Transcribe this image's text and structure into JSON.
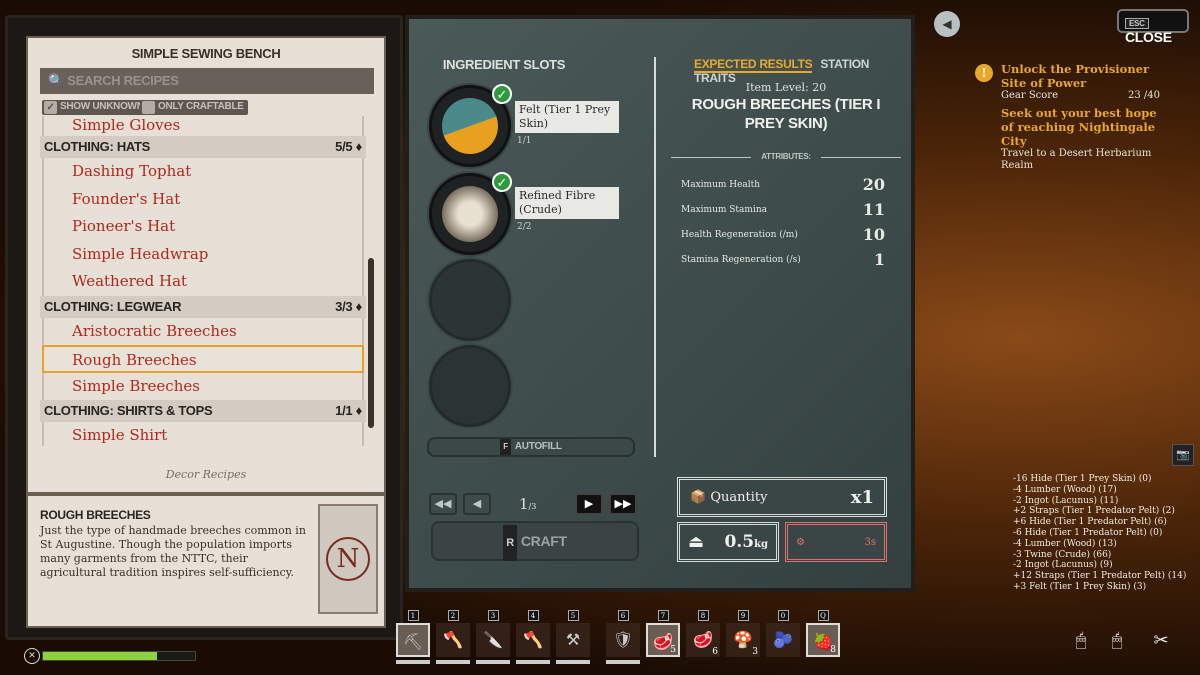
{
  "station": {
    "title": "SIMPLE SEWING BENCH",
    "search_placeholder": "SEARCH RECIPES",
    "show_unknown": "SHOW UNKNOWN",
    "only_craftable": "ONLY CRAFTABLE",
    "show_unknown_checked": true,
    "only_craftable_checked": false
  },
  "recipes": {
    "partial_item": "Simple Gloves",
    "groups": [
      {
        "name": "CLOTHING: HATS",
        "count": "5/5",
        "items": [
          "Dashing Tophat",
          "Founder's Hat",
          "Pioneer's Hat",
          "Simple Headwrap",
          "Weathered Hat"
        ]
      },
      {
        "name": "CLOTHING: LEGWEAR",
        "count": "3/3",
        "items": [
          "Aristocratic Breeches",
          "Rough Breeches",
          "Simple Breeches"
        ]
      },
      {
        "name": "CLOTHING: SHIRTS & TOPS",
        "count": "1/1",
        "items": [
          "Simple Shirt"
        ]
      }
    ],
    "selected": "Rough Breeches",
    "footer": "Decor Recipes"
  },
  "description": {
    "title": "ROUGH BREECHES",
    "text": "Just the type of handmade breeches common in St Augustine. Though the population imports many garments from the NTTC, their agricultural tradition inspires self-sufficiency.",
    "card_letter": "N"
  },
  "ingredients": {
    "title": "INGREDIENT SLOTS",
    "slots": [
      {
        "name": "Felt (Tier 1 Prey Skin)",
        "count": "1/1"
      },
      {
        "name": "Refined Fibre (Crude)",
        "count": "2/2"
      }
    ],
    "autofill_key": "F",
    "autofill": "AUTOFILL"
  },
  "pager": {
    "current": "1",
    "total": "/3"
  },
  "craft": {
    "key": "R",
    "label": "CRAFT"
  },
  "results": {
    "tabs": [
      "EXPECTED RESULTS",
      "STATION TRAITS"
    ],
    "active_tab": "EXPECTED RESULTS",
    "item_level": "Item Level: 20",
    "name": "ROUGH BREECHES (TIER I PREY SKIN)",
    "attributes_label": "ATTRIBUTES:",
    "attributes": [
      {
        "name": "Maximum Health",
        "value": "20"
      },
      {
        "name": "Maximum Stamina",
        "value": "11"
      },
      {
        "name": "Health Regeneration (/m)",
        "value": "10"
      },
      {
        "name": "Stamina Regeneration (/s)",
        "value": "1"
      }
    ],
    "quantity_label": "Quantity",
    "quantity": "x1",
    "weight": "0.5",
    "weight_unit": "kg",
    "time": "3s"
  },
  "close": {
    "key": "ESC",
    "label": "CLOSE"
  },
  "quests": [
    {
      "title": "Unlock the Provisioner Site of Power",
      "sub": "Gear Score",
      "progress": "23 /40"
    },
    {
      "title": "Seek out your best hope of reaching Nightingale City",
      "sub": "Travel to a Desert Herbarium Realm"
    }
  ],
  "log": [
    "-16 Hide (Tier 1 Prey Skin) (0)",
    "-4 Lumber (Wood) (17)",
    "-2 Ingot (Lacunus) (11)",
    "+2 Straps (Tier 1 Predator Pelt) (2)",
    "+6 Hide (Tier 1 Predator Pelt) (6)",
    "-6 Hide (Tier 1 Predator Pelt) (0)",
    "-4 Lumber (Wood) (13)",
    "-3 Twine (Crude) (66)",
    "-2 Ingot (Lacunus) (9)",
    "+12 Straps (Tier 1 Predator Pelt) (14)",
    "+3 Felt (Tier 1 Prey Skin) (3)"
  ],
  "hotbar": [
    {
      "key": "1",
      "icon": "pickaxe-icon",
      "count": ""
    },
    {
      "key": "2",
      "icon": "axe-icon",
      "count": ""
    },
    {
      "key": "3",
      "icon": "knife-icon",
      "count": ""
    },
    {
      "key": "4",
      "icon": "hatchet-icon",
      "count": ""
    },
    {
      "key": "5",
      "icon": "hoe-icon",
      "count": ""
    },
    {
      "key": "6",
      "icon": "shield-icon",
      "count": ""
    },
    {
      "key": "7",
      "icon": "meat-icon",
      "count": "5"
    },
    {
      "key": "8",
      "icon": "meat-icon",
      "count": "6"
    },
    {
      "key": "9",
      "icon": "mushroom-icon",
      "count": "3"
    },
    {
      "key": "0",
      "icon": "berries-icon",
      "count": ""
    },
    {
      "key": "Q",
      "icon": "potion-icon",
      "count": "8"
    }
  ],
  "health": {
    "fraction": 0.75,
    "color": "#8ed040"
  },
  "colors": {
    "accent": "#e8a82a",
    "recipe_text": "#b0281c",
    "panel": "#3a4a4a"
  }
}
